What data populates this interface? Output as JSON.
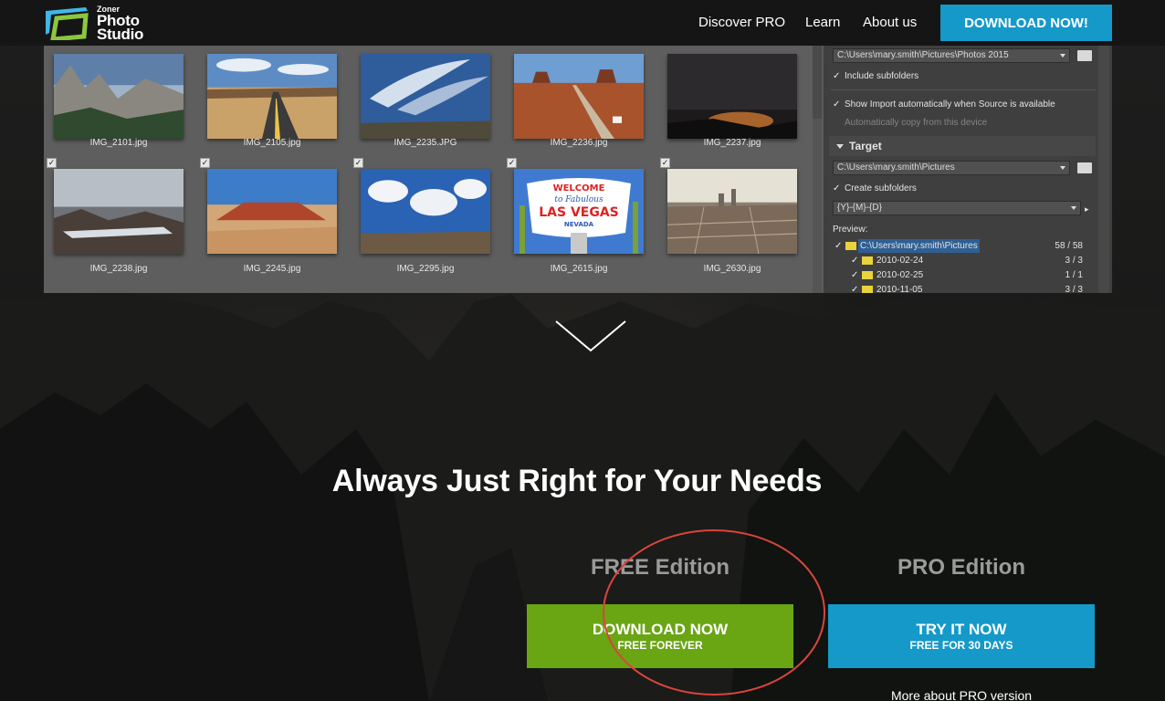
{
  "brand": {
    "logo_small": "Zoner",
    "logo_line1": "Photo",
    "logo_line2": "Studio",
    "accent_blue": "#1599c9",
    "accent_green": "#6aa514"
  },
  "nav": {
    "discover": "Discover PRO",
    "learn": "Learn",
    "about": "About us",
    "download": "DOWNLOAD NOW!"
  },
  "app": {
    "thumbnails": [
      {
        "name": "IMG_2101.jpg",
        "checked": false
      },
      {
        "name": "IMG_2105.jpg",
        "checked": false
      },
      {
        "name": "IMG_2235.JPG",
        "checked": false
      },
      {
        "name": "IMG_2236.jpg",
        "checked": false
      },
      {
        "name": "IMG_2237.jpg",
        "checked": false
      },
      {
        "name": "IMG_2238.jpg",
        "checked": true
      },
      {
        "name": "IMG_2245.jpg",
        "checked": true
      },
      {
        "name": "IMG_2295.jpg",
        "checked": true
      },
      {
        "name": "IMG_2615.jpg",
        "checked": true
      },
      {
        "name": "IMG_2630.jpg",
        "checked": true
      }
    ],
    "sign_lines": [
      "WELCOME",
      "to Fabulous",
      "LAS VEGAS",
      "NEVADA"
    ],
    "source": {
      "path": "C:\\Users\\mary.smith\\Pictures\\Photos 2015",
      "include_subfolders": "Include subfolders",
      "show_import": "Show Import automatically when Source is available",
      "auto_copy": "Automatically copy from this device"
    },
    "target": {
      "title": "Target",
      "path": "C:\\Users\\mary.smith\\Pictures",
      "create_subfolders": "Create subfolders",
      "pattern": "{Y}-{M}-{D}",
      "preview_label": "Preview:",
      "tree": [
        {
          "label": "C:\\Users\\mary.smith\\Pictures",
          "count": "58 / 58"
        },
        {
          "label": "2010-02-24",
          "count": "3 / 3"
        },
        {
          "label": "2010-02-25",
          "count": "1 / 1"
        },
        {
          "label": "2010-11-05",
          "count": "3 / 3"
        }
      ]
    }
  },
  "hero": {
    "headline": "Always Just Right for Your Needs",
    "free_title": "FREE Edition",
    "pro_title": "PRO Edition",
    "free_button_main": "DOWNLOAD NOW",
    "free_button_sub": "FREE FOREVER",
    "pro_button_main": "TRY IT NOW",
    "pro_button_sub": "FREE FOR 30 DAYS",
    "more_pro": "More about PRO version"
  }
}
